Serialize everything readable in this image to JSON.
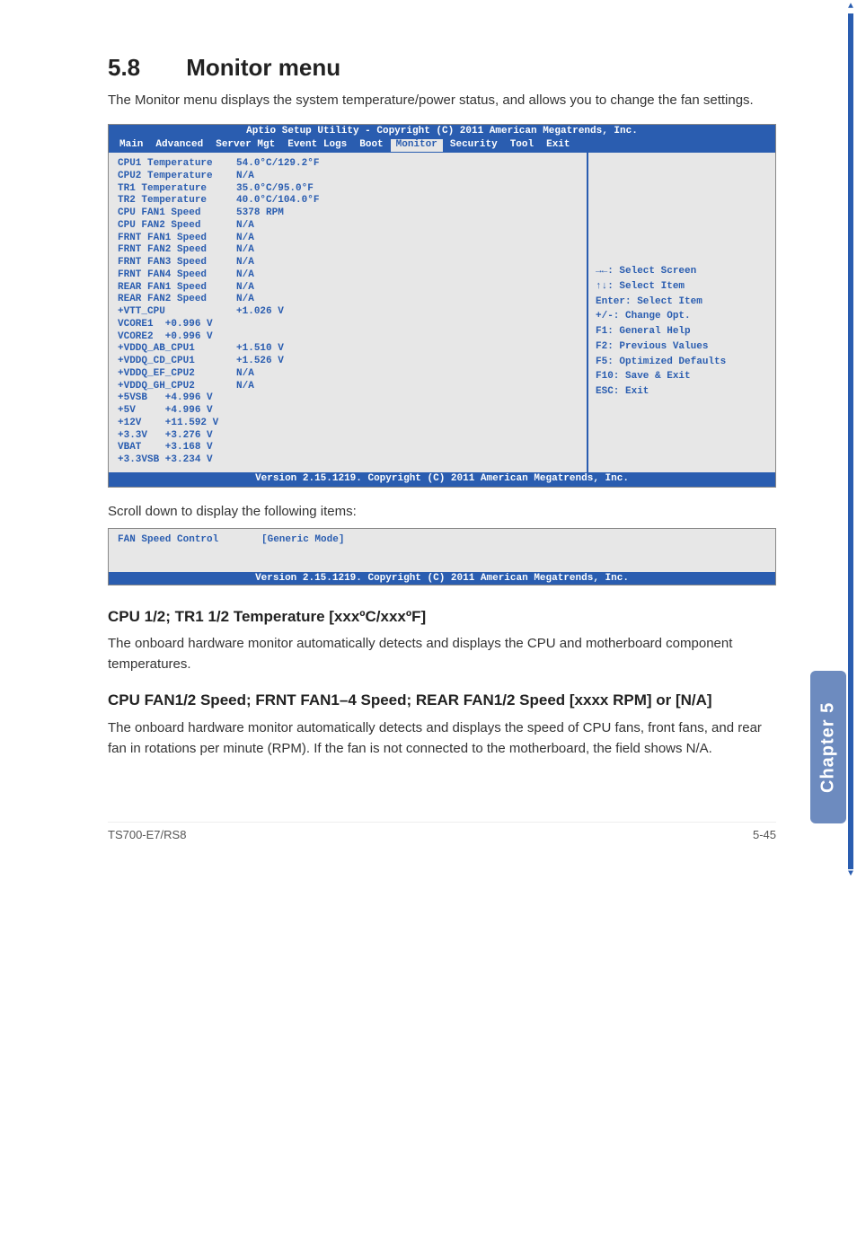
{
  "heading": {
    "num": "5.8",
    "title": "Monitor menu"
  },
  "intro": "The Monitor menu displays the system temperature/power status, and allows you to change the fan settings.",
  "bios": {
    "top": "Aptio Setup Utility - Copyright (C) 2011 American Megatrends, Inc.",
    "menu": [
      "Main",
      "Advanced",
      "Server Mgt",
      "Event Logs",
      "Boot",
      "Monitor",
      "Security",
      "Tool",
      "Exit"
    ],
    "menu_selected": "Monitor",
    "rows": [
      {
        "l": "CPU1 Temperature",
        "v": "54.0°C/129.2°F"
      },
      {
        "l": "CPU2 Temperature",
        "v": "N/A"
      },
      {
        "l": "TR1 Temperature",
        "v": "35.0°C/95.0°F"
      },
      {
        "l": "TR2 Temperature",
        "v": "40.0°C/104.0°F"
      },
      {
        "l": "CPU FAN1 Speed",
        "v": "5378 RPM"
      },
      {
        "l": "CPU FAN2 Speed",
        "v": "N/A"
      },
      {
        "l": "FRNT FAN1 Speed",
        "v": "N/A"
      },
      {
        "l": "FRNT FAN2 Speed",
        "v": "N/A"
      },
      {
        "l": "FRNT FAN3 Speed",
        "v": "N/A"
      },
      {
        "l": "FRNT FAN4 Speed",
        "v": "N/A"
      },
      {
        "l": "REAR FAN1 Speed",
        "v": "N/A"
      },
      {
        "l": "REAR FAN2 Speed",
        "v": "N/A"
      },
      {
        "l": "+VTT_CPU",
        "v": "+1.026 V"
      },
      {
        "l": "VCORE1  +0.996 V",
        "v": ""
      },
      {
        "l": "VCORE2  +0.996 V",
        "v": ""
      },
      {
        "l": "+VDDQ_AB_CPU1",
        "v": "+1.510 V"
      },
      {
        "l": "+VDDQ_CD_CPU1",
        "v": "+1.526 V"
      },
      {
        "l": "+VDDQ_EF_CPU2",
        "v": "N/A"
      },
      {
        "l": "+VDDQ_GH_CPU2",
        "v": "N/A"
      },
      {
        "l": "+5VSB   +4.996 V",
        "v": ""
      },
      {
        "l": "+5V     +4.996 V",
        "v": ""
      },
      {
        "l": "+12V    +11.592 V",
        "v": ""
      },
      {
        "l": "+3.3V   +3.276 V",
        "v": ""
      },
      {
        "l": "VBAT    +3.168 V",
        "v": ""
      },
      {
        "l": "+3.3VSB +3.234 V",
        "v": ""
      }
    ],
    "help": [
      "→←: Select Screen",
      "↑↓: Select Item",
      "Enter: Select Item",
      "+/-: Change Opt.",
      "F1: General Help",
      "F2: Previous Values",
      "F5: Optimized Defaults",
      "F10: Save & Exit",
      "ESC: Exit"
    ],
    "footer": "Version 2.15.1219. Copyright (C) 2011 American Megatrends, Inc."
  },
  "scroll_text": "Scroll down to display the following items:",
  "bios_small": {
    "row": {
      "l": "FAN Speed Control",
      "v": "[Generic Mode]"
    },
    "footer": "Version 2.15.1219. Copyright (C) 2011 American Megatrends, Inc."
  },
  "sub1": {
    "head": "CPU 1/2; TR1 1/2 Temperature [xxxºC/xxxºF]",
    "body": "The onboard hardware monitor automatically detects and displays the CPU and motherboard component temperatures."
  },
  "sub2": {
    "head": "CPU FAN1/2 Speed; FRNT FAN1–4 Speed; REAR FAN1/2 Speed [xxxx RPM] or [N/A]",
    "body": "The onboard hardware monitor automatically detects and displays the speed of CPU fans, front fans, and rear fan in rotations per minute (RPM). If the fan is not connected to the motherboard, the field shows N/A."
  },
  "side_tab": "Chapter 5",
  "footer": {
    "left": "TS700-E7/RS8",
    "right": "5-45"
  }
}
